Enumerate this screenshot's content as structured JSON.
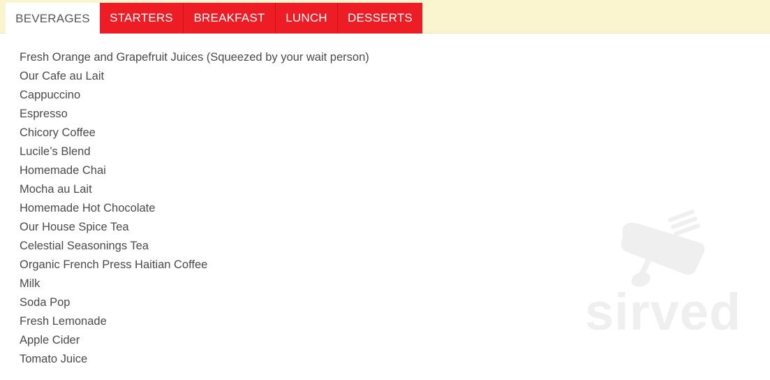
{
  "tabs": [
    {
      "label": "BEVERAGES",
      "active": true
    },
    {
      "label": "STARTERS",
      "active": false
    },
    {
      "label": "BREAKFAST",
      "active": false
    },
    {
      "label": "LUNCH",
      "active": false
    },
    {
      "label": "DESSERTS",
      "active": false
    }
  ],
  "menu_items": [
    "Fresh Orange and Grapefruit Juices (Squeezed by your wait person)",
    "Our Cafe au Lait",
    "Cappuccino",
    "Espresso",
    "Chicory Coffee",
    "Lucile’s Blend",
    "Homemade Chai",
    "Mocha au Lait",
    "Homemade Hot Chocolate",
    "Our House Spice Tea",
    "Celestial Seasonings Tea",
    "Organic French Press Haitian Coffee",
    "Milk",
    "Soda Pop",
    "Fresh Lemonade",
    "Apple Cider",
    "Tomato Juice"
  ],
  "watermark": {
    "text": "sirved",
    "icon": "knife-fork-spoon-icon"
  },
  "colors": {
    "tab_red": "#ee1c25",
    "tab_bar_bg": "#faf4cf",
    "text": "#4a4a4a"
  }
}
